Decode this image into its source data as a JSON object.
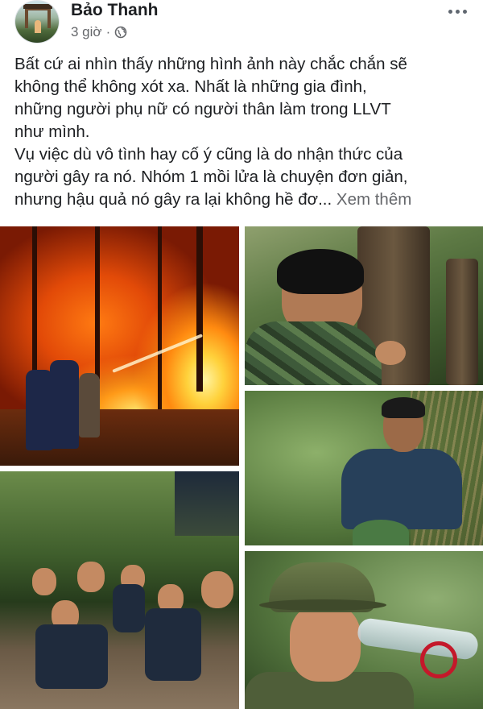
{
  "post": {
    "author": "Bảo Thanh",
    "time": "3 giờ",
    "separator": "·",
    "privacy_icon": "globe-icon",
    "more_icon": "more-options-icon",
    "text_lines": [
      "Bất cứ ai nhìn thấy những hình ảnh này chắc chắn sẽ",
      "không thể không xót xa. Nhất là những gia đình,",
      "những người phụ nữ có người thân làm trong LLVT",
      "như mình.",
      "Vụ việc dù vô tình hay cố ý cũng là do nhận thức của",
      "người gây ra nó. Nhóm 1 mồi lửa là chuyện đơn giản,",
      "nhưng hậu quả nó gây ra lại không hề đơ..."
    ],
    "see_more": "Xem thêm"
  },
  "colors": {
    "text": "#1c1e21",
    "secondary_text": "#65676b"
  }
}
